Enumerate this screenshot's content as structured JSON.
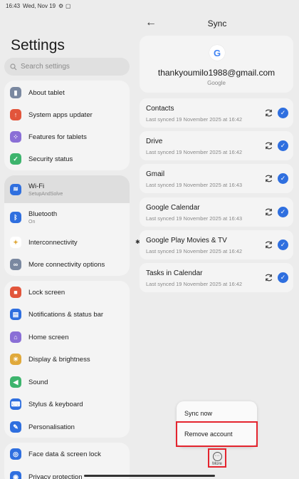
{
  "status": {
    "time": "16:43",
    "date": "Wed, Nov 19",
    "dots": "•••"
  },
  "left": {
    "title": "Settings",
    "search_placeholder": "Search settings",
    "items": [
      {
        "label": "About tablet",
        "color": "#7a88a0"
      },
      {
        "label": "System apps updater",
        "color": "#e2553b"
      },
      {
        "label": "Features for tablets",
        "color": "#8a6fd6"
      },
      {
        "label": "Security status",
        "color": "#3db46d"
      },
      {
        "label": "Wi-Fi",
        "sub": "SetupAndSolve",
        "color": "#2f6fdf"
      },
      {
        "label": "Bluetooth",
        "sub": "On",
        "color": "#2f6fdf"
      },
      {
        "label": "Interconnectivity",
        "color": "#e0a93b"
      },
      {
        "label": "More connectivity options",
        "color": "#7a88a0"
      },
      {
        "label": "Lock screen",
        "color": "#e2553b"
      },
      {
        "label": "Notifications & status bar",
        "color": "#2f6fdf"
      },
      {
        "label": "Home screen",
        "color": "#8a6fd6"
      },
      {
        "label": "Display & brightness",
        "color": "#e0a93b"
      },
      {
        "label": "Sound",
        "color": "#3db46d"
      },
      {
        "label": "Stylus & keyboard",
        "color": "#2f6fdf"
      },
      {
        "label": "Personalisation",
        "color": "#2f6fdf"
      },
      {
        "label": "Face data & screen lock",
        "color": "#2f6fdf"
      },
      {
        "label": "Privacy protection",
        "color": "#2f6fdf"
      }
    ]
  },
  "sync": {
    "title": "Sync",
    "email": "thankyoumilo1988@gmail.com",
    "provider": "Google",
    "logo_letter": "G",
    "items": [
      {
        "name": "Contacts",
        "when": "Last synced 19 November 2025 at 16:42"
      },
      {
        "name": "Drive",
        "when": "Last synced 19 November 2025 at 16:42"
      },
      {
        "name": "Gmail",
        "when": "Last synced 19 November 2025 at 16:43"
      },
      {
        "name": "Google Calendar",
        "when": "Last synced 19 November 2025 at 16:43"
      },
      {
        "name": "Google Play Movies & TV",
        "when": "Last synced 19 November 2025 at 16:42"
      },
      {
        "name": "Tasks in Calendar",
        "when": "Last synced 19 November 2025 at 16:42"
      }
    ],
    "menu": {
      "sync_now": "Sync now",
      "remove_account": "Remove account"
    },
    "more_label": "More"
  },
  "accent_color": "#2f6fdf",
  "highlight_color": "#e4242e"
}
